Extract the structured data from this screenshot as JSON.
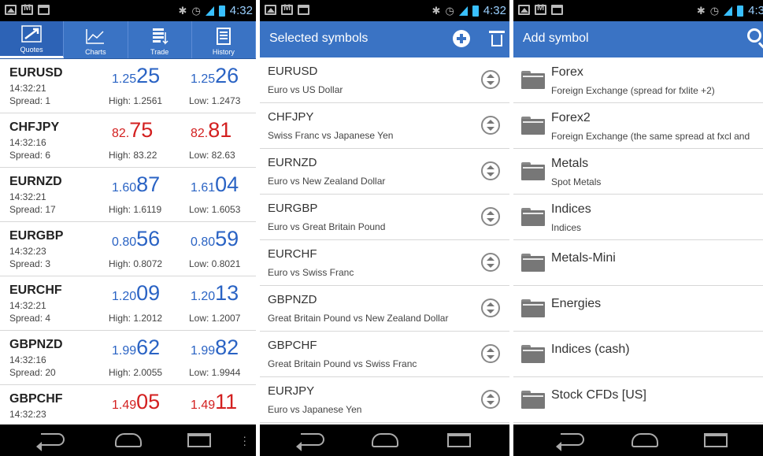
{
  "status": {
    "time": "4:32",
    "time_p3": "4:3"
  },
  "quotes_tabs": [
    {
      "label": "Quotes",
      "icon": "arrows-icon"
    },
    {
      "label": "Charts",
      "icon": "chart-icon"
    },
    {
      "label": "Trade",
      "icon": "trade-icon"
    },
    {
      "label": "History",
      "icon": "history-icon"
    }
  ],
  "quotes": [
    {
      "symbol": "EURUSD",
      "time": "14:32:21",
      "spread": "Spread: 1",
      "bid_small": "1.25",
      "bid_big": "25",
      "ask_small": "1.25",
      "ask_big": "26",
      "high": "High: 1.2561",
      "low": "Low: 1.2473",
      "color": "#2a63c4"
    },
    {
      "symbol": "CHFJPY",
      "time": "14:32:16",
      "spread": "Spread: 6",
      "bid_small": "82.",
      "bid_big": "75",
      "ask_small": "82.",
      "ask_big": "81",
      "high": "High: 83.22",
      "low": "Low: 82.63",
      "color": "#d32020"
    },
    {
      "symbol": "EURNZD",
      "time": "14:32:21",
      "spread": "Spread: 17",
      "bid_small": "1.60",
      "bid_big": "87",
      "ask_small": "1.61",
      "ask_big": "04",
      "high": "High: 1.6119",
      "low": "Low: 1.6053",
      "color": "#2a63c4"
    },
    {
      "symbol": "EURGBP",
      "time": "14:32:23",
      "spread": "Spread: 3",
      "bid_small": "0.80",
      "bid_big": "56",
      "ask_small": "0.80",
      "ask_big": "59",
      "high": "High: 0.8072",
      "low": "Low: 0.8021",
      "color": "#2a63c4"
    },
    {
      "symbol": "EURCHF",
      "time": "14:32:21",
      "spread": "Spread: 4",
      "bid_small": "1.20",
      "bid_big": "09",
      "ask_small": "1.20",
      "ask_big": "13",
      "high": "High: 1.2012",
      "low": "Low: 1.2007",
      "color": "#2a63c4"
    },
    {
      "symbol": "GBPNZD",
      "time": "14:32:16",
      "spread": "Spread: 20",
      "bid_small": "1.99",
      "bid_big": "62",
      "ask_small": "1.99",
      "ask_big": "82",
      "high": "High: 2.0055",
      "low": "Low: 1.9944",
      "color": "#2a63c4"
    },
    {
      "symbol": "GBPCHF",
      "time": "14:32:23",
      "spread": "",
      "bid_small": "1.49",
      "bid_big": "05",
      "ask_small": "1.49",
      "ask_big": "11",
      "high": "",
      "low": "",
      "color": "#d32020"
    }
  ],
  "selected": {
    "title": "Selected symbols",
    "items": [
      {
        "symbol": "EURUSD",
        "desc": "Euro vs US Dollar"
      },
      {
        "symbol": "CHFJPY",
        "desc": "Swiss Franc vs Japanese Yen"
      },
      {
        "symbol": "EURNZD",
        "desc": "Euro vs New Zealand Dollar"
      },
      {
        "symbol": "EURGBP",
        "desc": "Euro vs Great Britain Pound"
      },
      {
        "symbol": "EURCHF",
        "desc": "Euro vs Swiss Franc"
      },
      {
        "symbol": "GBPNZD",
        "desc": "Great Britain Pound vs New Zealand Dollar"
      },
      {
        "symbol": "GBPCHF",
        "desc": "Great Britain Pound vs Swiss Franc"
      },
      {
        "symbol": "EURJPY",
        "desc": "Euro vs Japanese Yen"
      }
    ]
  },
  "add": {
    "title": "Add symbol",
    "items": [
      {
        "name": "Forex",
        "desc": "Foreign Exchange (spread for fxlite +2)"
      },
      {
        "name": "Forex2",
        "desc": "Foreign Exchange (the same spread at fxcl and"
      },
      {
        "name": "Metals",
        "desc": "Spot Metals"
      },
      {
        "name": "Indices",
        "desc": "Indices"
      },
      {
        "name": "Metals-Mini",
        "desc": ""
      },
      {
        "name": "Energies",
        "desc": ""
      },
      {
        "name": "Indices (cash)",
        "desc": ""
      },
      {
        "name": "Stock CFDs [US]",
        "desc": ""
      }
    ]
  }
}
